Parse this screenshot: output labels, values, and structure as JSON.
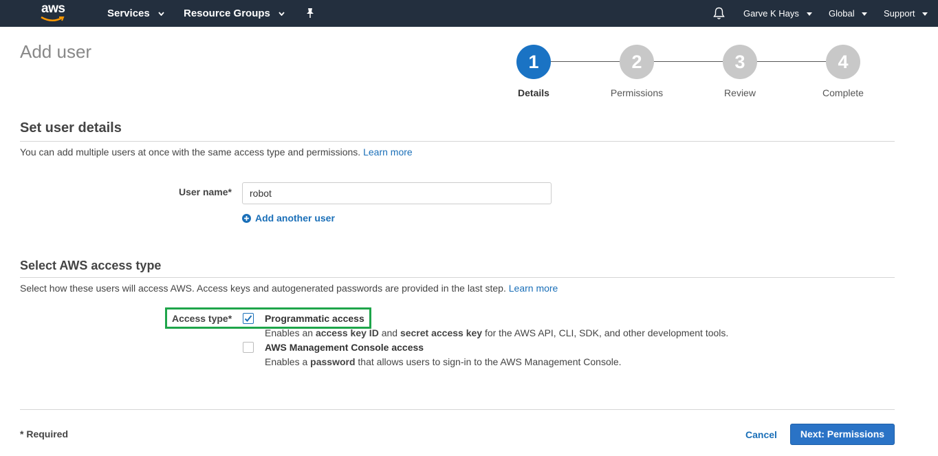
{
  "nav": {
    "logo_text": "aws",
    "services": "Services",
    "resource_groups": "Resource Groups",
    "user": "Garve K Hays",
    "region": "Global",
    "support": "Support",
    "bg_color": "#232f3e"
  },
  "page": {
    "title": "Add user"
  },
  "wizard": {
    "steps": [
      {
        "number": "1",
        "label": "Details",
        "active": true
      },
      {
        "number": "2",
        "label": "Permissions",
        "active": false
      },
      {
        "number": "3",
        "label": "Review",
        "active": false
      },
      {
        "number": "4",
        "label": "Complete",
        "active": false
      }
    ],
    "active_color": "#1a73c4"
  },
  "user_details": {
    "title": "Set user details",
    "description": "You can add multiple users at once with the same access type and permissions.",
    "learn_more": "Learn more",
    "username_label": "User name*",
    "username_value": "robot",
    "add_another": "Add another user"
  },
  "access_type": {
    "title": "Select AWS access type",
    "description": "Select how these users will access AWS. Access keys and autogenerated passwords are provided in the last step.",
    "learn_more": "Learn more",
    "label": "Access type*",
    "options": [
      {
        "title": "Programmatic access",
        "checked": true,
        "desc_parts": [
          "Enables an ",
          "access key ID",
          " and ",
          "secret access key",
          " for the AWS API, CLI, SDK, and other development tools."
        ]
      },
      {
        "title": "AWS Management Console access",
        "checked": false,
        "desc_parts": [
          "Enables a ",
          "password",
          " that allows users to sign-in to the AWS Management Console."
        ]
      }
    ],
    "highlight_color": "#1ea54a"
  },
  "footer": {
    "required": "* Required",
    "cancel": "Cancel",
    "next": "Next: Permissions"
  }
}
